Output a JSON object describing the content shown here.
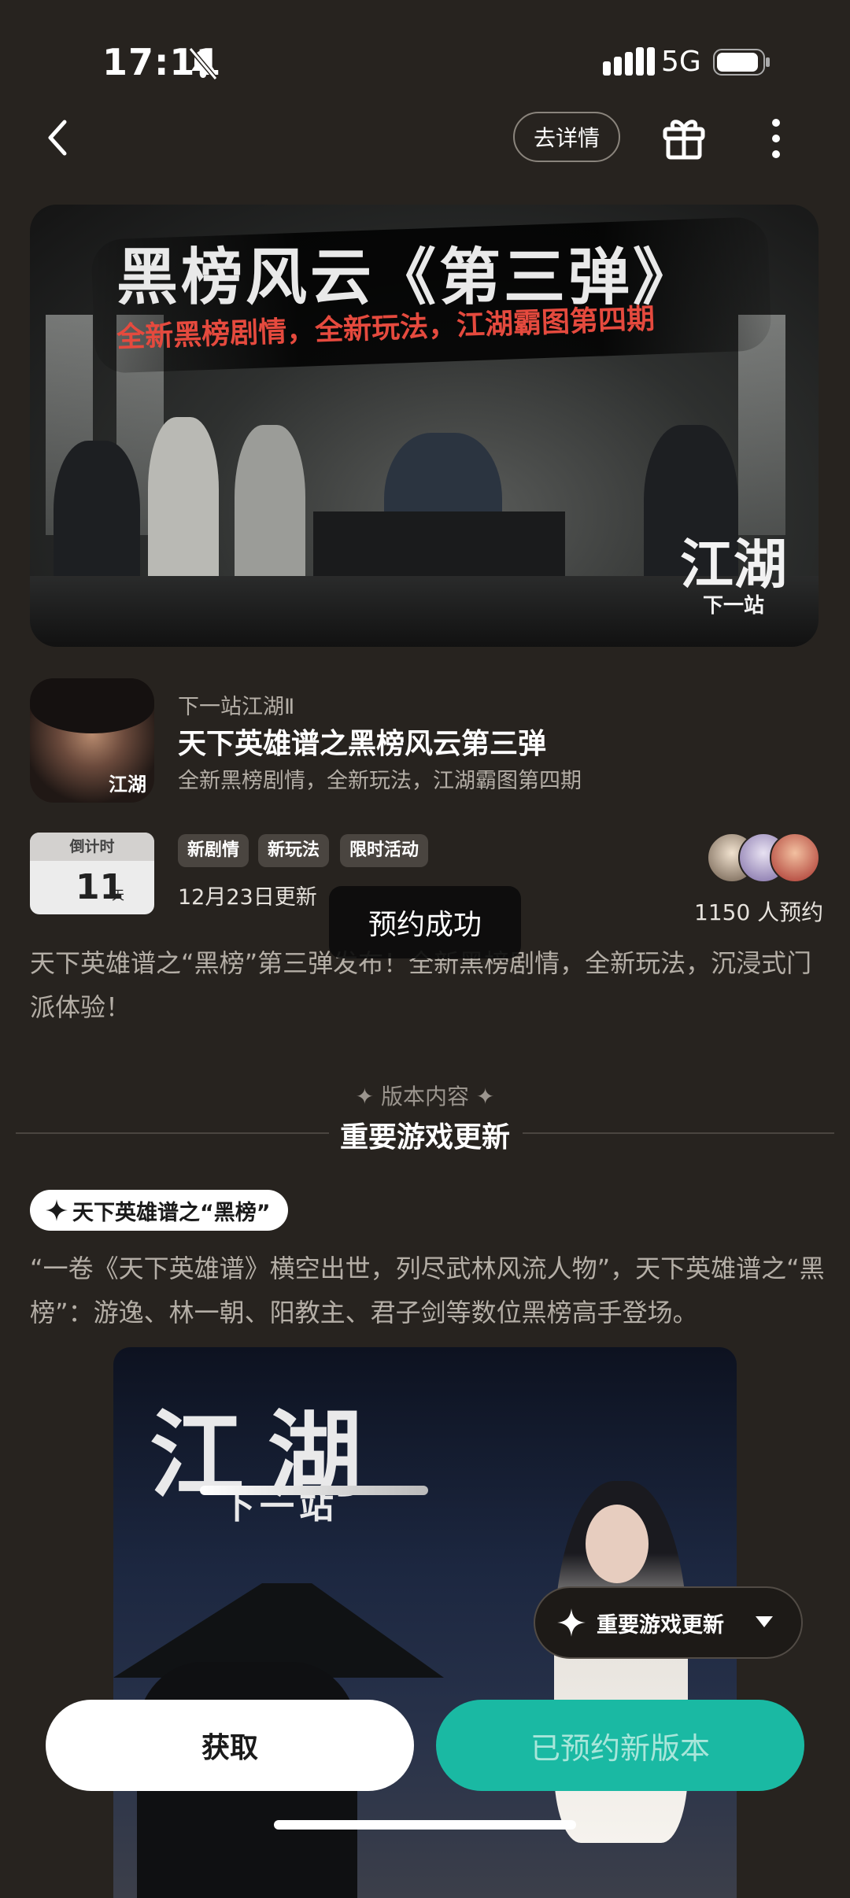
{
  "status_bar": {
    "time": "17:11",
    "network": "5G"
  },
  "nav": {
    "detail_label": "去详情"
  },
  "banner": {
    "title": "黑榜风云《第三弹》",
    "subtitle": "全新黑榜剧情，全新玩法，江湖霸图第四期",
    "logo_main": "江湖",
    "logo_small": "下一站"
  },
  "game": {
    "icon_mark": "江湖",
    "name": "下一站江湖Ⅱ",
    "title": "天下英雄谱之黑榜风云第三弹",
    "description": "全新黑榜剧情，全新玩法，江湖霸图第四期"
  },
  "countdown": {
    "label": "倒计时",
    "value": "11",
    "unit": "天"
  },
  "tags": [
    "新剧情",
    "新玩法",
    "限时活动"
  ],
  "update_date": "12月23日更新",
  "reservations": {
    "count_text": "1150 人预约"
  },
  "toast": "预约成功",
  "intro": "天下英雄谱之“黑榜”第三弹发布！全新黑榜剧情，全新玩法，沉浸式门派体验！",
  "section": {
    "label": "✦ 版本内容 ✦",
    "title": "重要游戏更新"
  },
  "content": {
    "pill_label": "天下英雄谱之“黑榜”",
    "paragraph": "“一卷《天下英雄谱》横空出世，列尽武林风流人物”，天下英雄谱之“黑榜”：游逸、林一朝、阳教主、君子剑等数位黑榜高手登场。"
  },
  "poster": {
    "logo_main": "江湖",
    "logo_small": "下一站"
  },
  "floating_switch": {
    "label": "重要游戏更新"
  },
  "buttons": {
    "get": "获取",
    "reserved": "已预约新版本"
  },
  "colors": {
    "background": "#27231f",
    "accent": "#1ab9a3"
  }
}
